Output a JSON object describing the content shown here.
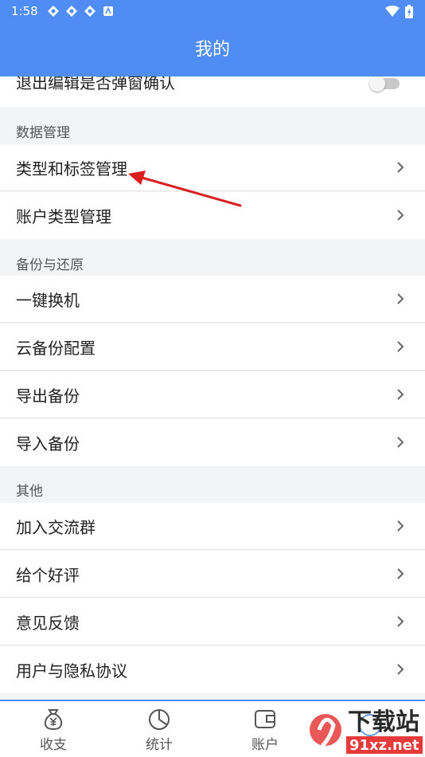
{
  "status_bar": {
    "time": "1:58"
  },
  "header": {
    "title": "我的"
  },
  "partial_row": {
    "label": "退出编辑是否弹窗确认"
  },
  "sections": {
    "data_mgmt": "数据管理",
    "backup": "备份与还原",
    "other": "其他"
  },
  "rows": {
    "type_tag": "类型和标签管理",
    "account_type": "账户类型管理",
    "one_click": "一键换机",
    "cloud_backup": "云备份配置",
    "export": "导出备份",
    "import": "导入备份",
    "join_group": "加入交流群",
    "rate": "给个好评",
    "feedback": "意见反馈",
    "privacy": "用户与隐私协议"
  },
  "tabs": {
    "income": "收支",
    "stats": "统计",
    "account": "账户"
  },
  "watermark": {
    "text": "下载站",
    "url_text": "91xz.net"
  }
}
